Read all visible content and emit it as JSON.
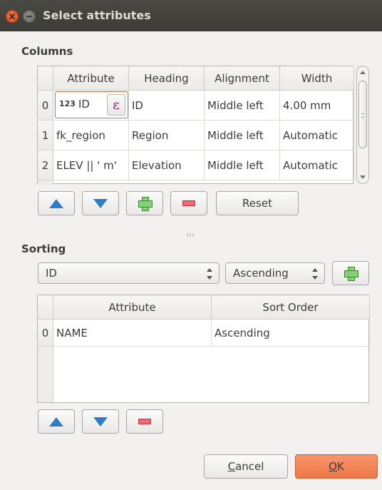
{
  "window": {
    "title": "Select attributes"
  },
  "columns": {
    "section_label": "Columns",
    "headers": [
      "Attribute",
      "Heading",
      "Alignment",
      "Width"
    ],
    "rows": [
      {
        "index": "0",
        "type_badge": "123",
        "attribute": "ID",
        "heading": "ID",
        "alignment": "Middle left",
        "width": "4.00 mm"
      },
      {
        "index": "1",
        "attribute": "fk_region",
        "heading": "Region",
        "alignment": "Middle left",
        "width": "Automatic"
      },
      {
        "index": "2",
        "attribute": "ELEV || ' m'",
        "heading": "Elevation",
        "alignment": "Middle left",
        "width": "Automatic"
      }
    ],
    "expression_glyph": "ε",
    "reset_label": "Reset"
  },
  "sorting": {
    "section_label": "Sorting",
    "field_combo": "ID",
    "order_combo": "Ascending",
    "headers": [
      "Attribute",
      "Sort Order"
    ],
    "rows": [
      {
        "index": "0",
        "attribute": "NAME",
        "sort_order": "Ascending"
      }
    ]
  },
  "footer": {
    "cancel_mnemonic": "C",
    "cancel_rest": "ancel",
    "ok_mnemonic": "O",
    "ok_rest": "K"
  },
  "colors": {
    "titlebar": "#3c3b37",
    "accent": "#ef7647",
    "arrow": "#2f7dc6",
    "add": "#8ad07a",
    "remove": "#f06a76"
  }
}
